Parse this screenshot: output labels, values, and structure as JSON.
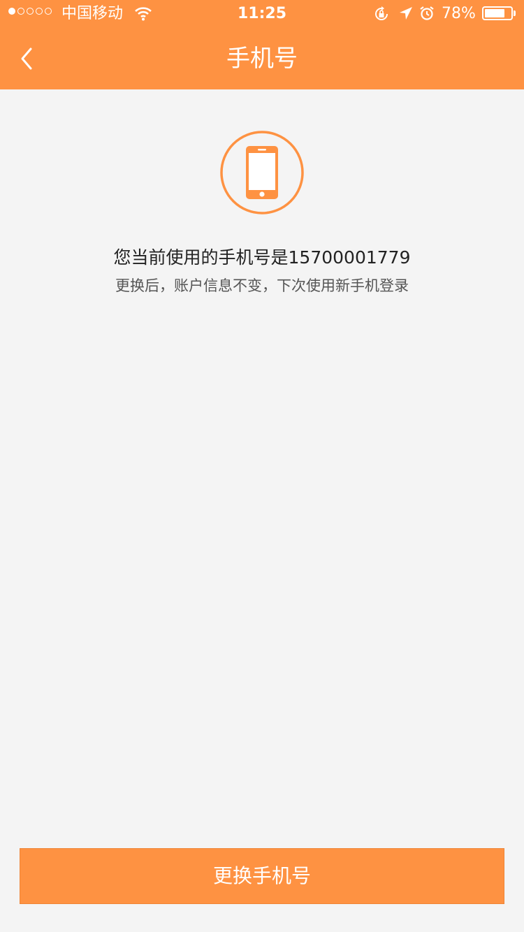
{
  "status_bar": {
    "carrier": "中国移动",
    "time": "11:25",
    "battery_percent": "78%",
    "battery_level": 0.78
  },
  "header": {
    "title": "手机号"
  },
  "content": {
    "current_number_text": "您当前使用的手机号是15700001779",
    "hint_text": "更换后，账户信息不变，下次使用新手机登录"
  },
  "actions": {
    "change_button_label": "更换手机号"
  },
  "icons": {
    "back": "chevron-left-icon",
    "phone": "smartphone-icon"
  },
  "colors": {
    "accent": "#fe9242",
    "background": "#f4f4f4"
  }
}
